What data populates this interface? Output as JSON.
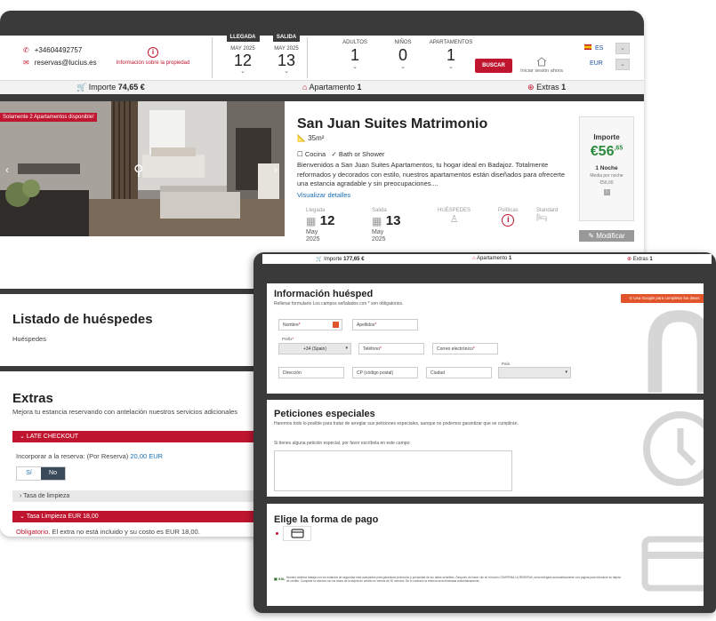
{
  "header": {
    "phone": "+34604492757",
    "email": "reservas@lucius.es",
    "property_info": "Información sobre la propiedad",
    "arrival": {
      "tag": "LLEGADA",
      "month": "MAY 2025",
      "day": "12"
    },
    "departure": {
      "tag": "SALIDA",
      "month": "MAY 2025",
      "day": "13"
    },
    "adults": {
      "label": "ADULTOS",
      "value": "1"
    },
    "kids": {
      "label": "NIÑOS",
      "value": "0"
    },
    "apartments": {
      "label": "APARTAMENTOS",
      "value": "1"
    },
    "search_label": "BUSCAR",
    "session_label": "Iniciar sesión ahora",
    "language": "ES",
    "currency": "EUR"
  },
  "summary": {
    "importe_label": "Importe",
    "importe_value": "74,65 €",
    "apartamento_label": "Apartamento",
    "apartamento_value": "1",
    "extras_label": "Extras",
    "extras_value": "1"
  },
  "room": {
    "badge": "Solamente 2 Apartamentos disponible!",
    "title": "San Juan Suites Matrimonio",
    "size": "35m²",
    "feature1": "Cocina",
    "feature2": "Bath or Shower",
    "description": "Bienvenidos a San Juan Suites Apartamentos, tu hogar ideal en Badajoz. Totalmente reformados y decorados con estilo, nuestros apartamentos están diseñados para ofrecerte una estancia agradable y sin preocupaciones....",
    "details_link": "Visualizar detalles",
    "arrival_label": "Llegada",
    "arrival_day": "12",
    "arrival_month": "May",
    "arrival_year": "2025",
    "departure_label": "Salida",
    "departure_day": "13",
    "departure_month": "May",
    "departure_year": "2025",
    "guests_label": "HUÉSPEDES",
    "policies_label": "Políticas",
    "standard_label": "Standard",
    "price_label": "Importe",
    "price_main": "€56",
    "price_cents": ",65",
    "nights": "1 Noche",
    "per_night_label": "Media por noche",
    "per_night_value": "€56,65",
    "modify_label": "Modificar"
  },
  "guests_section": {
    "title": "Listado de huéspedes",
    "subtitle": "Huéspedes"
  },
  "extras": {
    "title": "Extras",
    "subtitle": "Mejora tu estancia reservando con antelación nuestros servicios adicionales",
    "late_checkout": "LATE CHECKOUT",
    "incorporate": "Incorporar a la reserva: (Por Reserva)",
    "incorporate_price": "20,00 EUR",
    "yes": "Sí",
    "no": "No",
    "tasa_limpieza": "Tasa de limpieza",
    "tasa_limpieza_price": "Tasa Limpieza EUR 18,00",
    "obligatorio": "Obligatorio.",
    "obligatorio_note": "El extra no está incluido y su costo es EUR 18,00."
  },
  "front_summary": {
    "importe_label": "Importe",
    "importe_value": "177,65 €",
    "apartamento_label": "Apartamento",
    "apartamento_value": "1",
    "extras_label": "Extras",
    "extras_value": "1"
  },
  "guest_info": {
    "title": "Información huésped",
    "subtitle": "Rellenar formulario Los campos señalados con * son obligatorios.",
    "google_label": "Usa Google para completar los datos",
    "name": "Nombre",
    "surname": "Apellidos",
    "prefix_label": "Prefix",
    "prefix_value": "+34 (Spain)",
    "phone": "Teléfono",
    "email": "Correo electrónico",
    "address": "Dirección",
    "postal": "CP (código postal)",
    "city": "Ciudad",
    "country_label": "País"
  },
  "special_requests": {
    "title": "Peticiones especiales",
    "subtitle": "Haremos todo lo posible para tratar de arreglar sus peticiones especiales, aunque no podemos garantizar que se cumplirán.",
    "textarea_label": "Si tienes alguna petición especial, por favor escríbela en este campo:"
  },
  "payment": {
    "title": "Elige la forma de pago",
    "ssl_label": "SSL",
    "legal": "Nuestro sistema trabaja con los estándar de seguridad más avanzados para garantizar protección y privacidad de tus datos sensibles. Después de hacer clic en el botón CONFIRMA LA RESERVA, será redirigido automáticamente a la página para introducir su tarjeta de crédito. Complete la reserva con los datos de la tarjeta de crédito en menos de 30 minutos. De lo contrario la reserva será eliminada automáticamente."
  },
  "colors": {
    "accent": "#c0152f",
    "dark": "#3a3a3a",
    "price_green": "#2b8a3e",
    "link_blue": "#1a6fb5"
  }
}
